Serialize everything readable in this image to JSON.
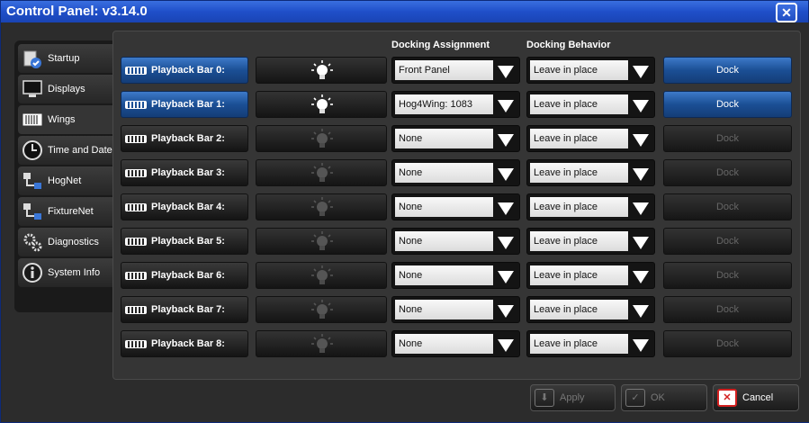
{
  "window": {
    "title": "Control Panel: v3.14.0"
  },
  "tabs": [
    {
      "label": "Startup",
      "icon": "startup-icon"
    },
    {
      "label": "Displays",
      "icon": "monitor-icon"
    },
    {
      "label": "Wings",
      "icon": "wing-icon"
    },
    {
      "label": "Time and Date",
      "icon": "clock-icon"
    },
    {
      "label": "HogNet",
      "icon": "network-icon"
    },
    {
      "label": "FixtureNet",
      "icon": "network-icon"
    },
    {
      "label": "Diagnostics",
      "icon": "gears-icon"
    },
    {
      "label": "System Info",
      "icon": "info-icon"
    }
  ],
  "active_tab": "Wings",
  "headers": {
    "docking_assignment": "Docking Assignment",
    "docking_behavior": "Docking Behavior"
  },
  "rows": [
    {
      "label": "Playback Bar 0:",
      "assignment": "Front Panel",
      "behavior": "Leave in place",
      "dock": "Dock"
    },
    {
      "label": "Playback Bar 1:",
      "assignment": "Hog4Wing: 1083",
      "behavior": "Leave in place",
      "dock": "Dock"
    },
    {
      "label": "Playback Bar 2:",
      "assignment": "None",
      "behavior": "Leave in place",
      "dock": "Dock"
    },
    {
      "label": "Playback Bar 3:",
      "assignment": "None",
      "behavior": "Leave in place",
      "dock": "Dock"
    },
    {
      "label": "Playback Bar 4:",
      "assignment": "None",
      "behavior": "Leave in place",
      "dock": "Dock"
    },
    {
      "label": "Playback Bar 5:",
      "assignment": "None",
      "behavior": "Leave in place",
      "dock": "Dock"
    },
    {
      "label": "Playback Bar 6:",
      "assignment": "None",
      "behavior": "Leave in place",
      "dock": "Dock"
    },
    {
      "label": "Playback Bar 7:",
      "assignment": "None",
      "behavior": "Leave in place",
      "dock": "Dock"
    },
    {
      "label": "Playback Bar 8:",
      "assignment": "None",
      "behavior": "Leave in place",
      "dock": "Dock"
    }
  ],
  "footer": {
    "apply": "Apply",
    "ok": "OK",
    "cancel": "Cancel"
  },
  "colors": {
    "accent": "#1b4f95",
    "title_bar": "#1f4fc9",
    "cancel_red": "#d32020"
  }
}
